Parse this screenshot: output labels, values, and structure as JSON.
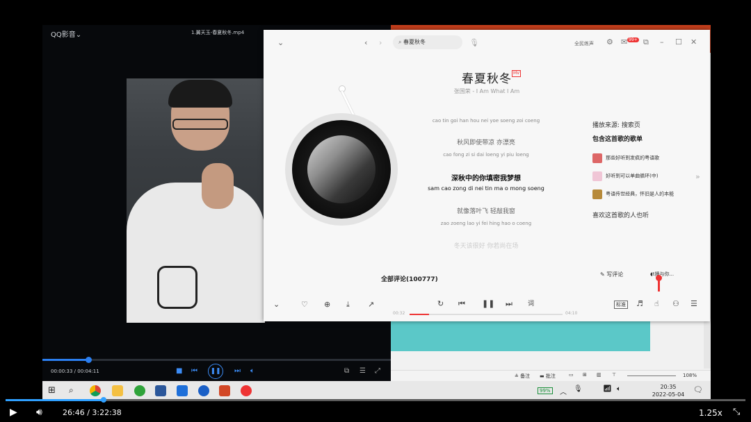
{
  "qq_player": {
    "brand": "QQ影音",
    "brand_chevron": "⌄",
    "file_title": "1.翼天玉-春夏秋冬.mp4",
    "time": "00:00:33 / 00:04:11",
    "progress": 0.13
  },
  "music": {
    "search_value": "春夏秋冬",
    "top_links": [
      "全民练声"
    ],
    "badge": "99+",
    "song_title": "春夏秋冬",
    "mv_badge": "MV",
    "artist_album": "张国荣 - I Am What I Am",
    "lyrics": [
      {
        "pinyin": "cao tin goi han hou nei yoe soeng zoi coeng",
        "cn": "",
        "active": false
      },
      {
        "pinyin": "cao fong zi si dai loeng yi piu loeng",
        "cn": "秋风即使带凉 亦漂亮",
        "active": false
      },
      {
        "pinyin": "sam cao zong di nei tin ma o mong soeng",
        "cn": "深秋中的你填密我梦想",
        "active": true
      },
      {
        "pinyin": "zao zoeng lao yi fei hing hao o coeng",
        "cn": "就像落叶飞 轻敲我窗",
        "active": false
      },
      {
        "pinyin": "",
        "cn": "冬天该很好 你若尚在场",
        "active": false
      }
    ],
    "side": {
      "source": "播放来源: 搜索页",
      "playlists_heading": "包含这首歌的歌单",
      "playlists": [
        "那些好听到发疯的粤语歌",
        "好听到可以单曲循环(中)",
        "粤语传世经典，怀旧是人的本能"
      ],
      "likers_heading": "喜欢这首歌的人也听"
    },
    "comments_label": "全部评论(100777)",
    "write_comment": "写评论",
    "share_to": "t播与你...",
    "lyric_btn": "词",
    "quality": "标准",
    "time_current": "00:32",
    "time_total": "04:10",
    "progress": 0.13
  },
  "ppt": {
    "status": [
      "备注",
      "批注"
    ],
    "zoom": "108%"
  },
  "taskbar": {
    "battery": "99%",
    "time": "20:35",
    "date": "2022-05-04"
  },
  "outer_player": {
    "time": "26:46 / 3:22:38",
    "speed": "1.25x",
    "progress": 0.133
  },
  "colors": {
    "qq_accent": "#2b7ff0",
    "music_red": "#e33e3e",
    "ppt_red": "#c43e1c",
    "slide_cyan": "#5bc8c8"
  }
}
